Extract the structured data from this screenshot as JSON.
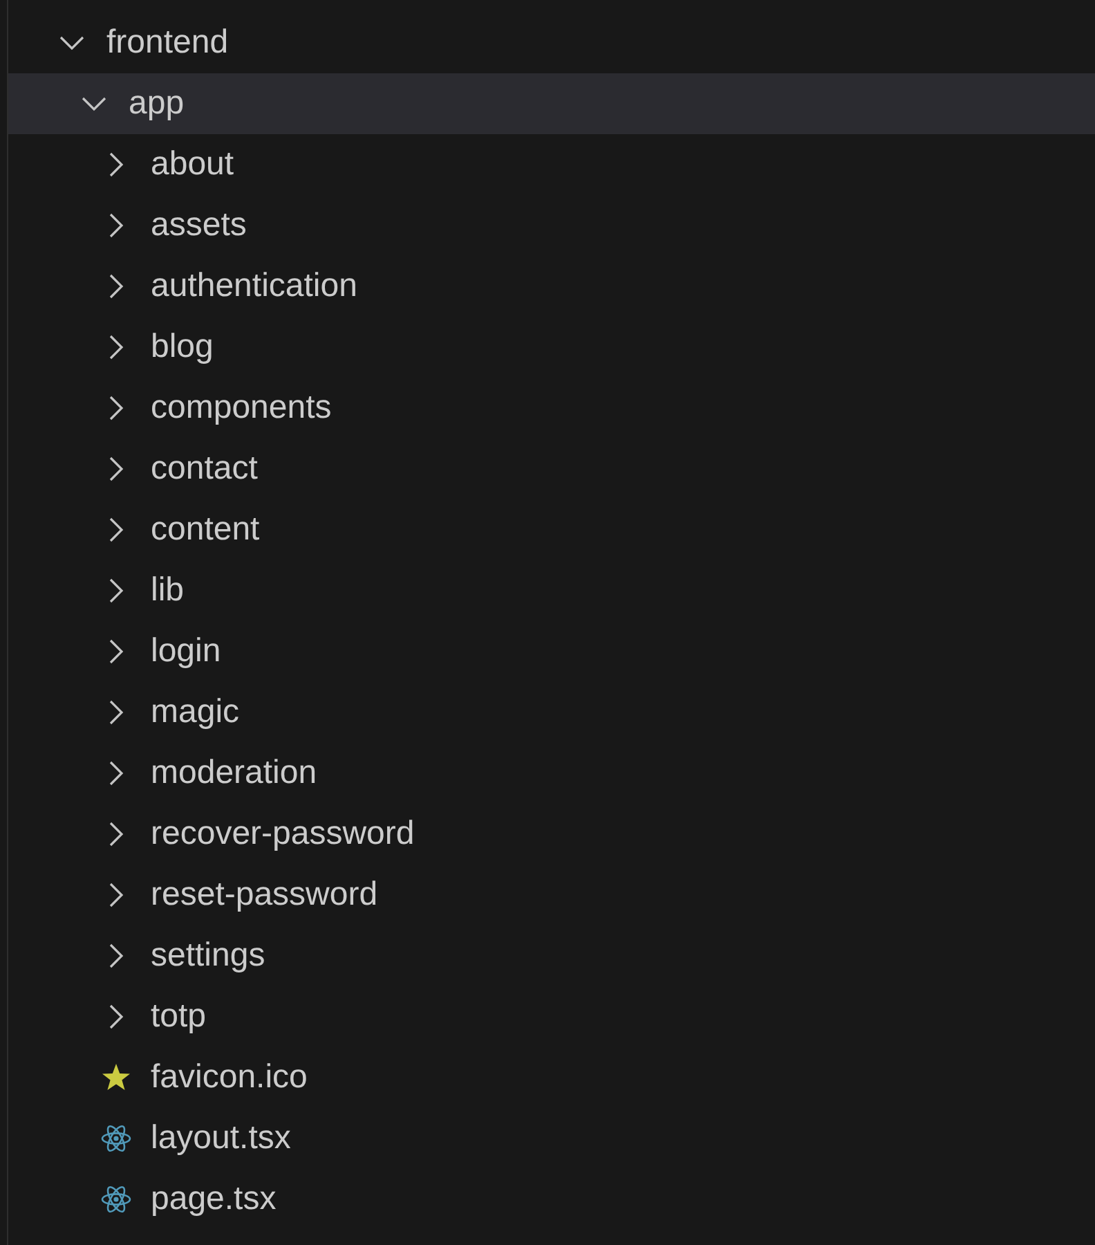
{
  "tree": [
    {
      "label": "frontend",
      "kind": "folder",
      "expanded": true,
      "selected": false,
      "children": [
        {
          "label": "app",
          "kind": "folder",
          "expanded": true,
          "selected": true,
          "children": [
            {
              "label": "about",
              "kind": "folder",
              "expanded": false,
              "selected": false
            },
            {
              "label": "assets",
              "kind": "folder",
              "expanded": false,
              "selected": false
            },
            {
              "label": "authentication",
              "kind": "folder",
              "expanded": false,
              "selected": false
            },
            {
              "label": "blog",
              "kind": "folder",
              "expanded": false,
              "selected": false
            },
            {
              "label": "components",
              "kind": "folder",
              "expanded": false,
              "selected": false
            },
            {
              "label": "contact",
              "kind": "folder",
              "expanded": false,
              "selected": false
            },
            {
              "label": "content",
              "kind": "folder",
              "expanded": false,
              "selected": false
            },
            {
              "label": "lib",
              "kind": "folder",
              "expanded": false,
              "selected": false
            },
            {
              "label": "login",
              "kind": "folder",
              "expanded": false,
              "selected": false
            },
            {
              "label": "magic",
              "kind": "folder",
              "expanded": false,
              "selected": false
            },
            {
              "label": "moderation",
              "kind": "folder",
              "expanded": false,
              "selected": false
            },
            {
              "label": "recover-password",
              "kind": "folder",
              "expanded": false,
              "selected": false
            },
            {
              "label": "reset-password",
              "kind": "folder",
              "expanded": false,
              "selected": false
            },
            {
              "label": "settings",
              "kind": "folder",
              "expanded": false,
              "selected": false
            },
            {
              "label": "totp",
              "kind": "folder",
              "expanded": false,
              "selected": false
            },
            {
              "label": "favicon.ico",
              "kind": "image",
              "selected": false
            },
            {
              "label": "layout.tsx",
              "kind": "react",
              "selected": false
            },
            {
              "label": "page.tsx",
              "kind": "react",
              "selected": false
            }
          ]
        }
      ]
    }
  ]
}
